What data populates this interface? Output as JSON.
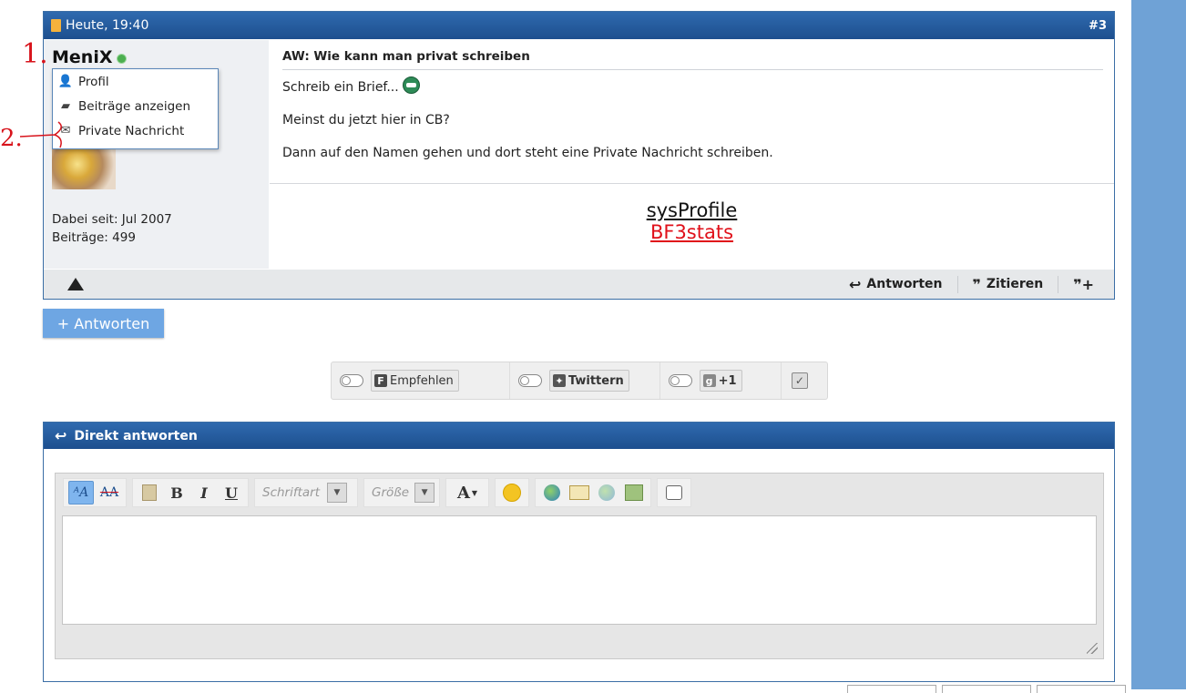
{
  "post": {
    "date": "Heute, 19:40",
    "number": "#3",
    "username": "MeniX",
    "joined": "Dabei seit: Jul 2007",
    "posts": "Beiträge: 499",
    "title": "AW: Wie kann man privat schreiben",
    "body_line1": "Schreib ein Brief...",
    "body_line2": "Meinst du jetzt hier in CB?",
    "body_line3": "Dann auf den Namen gehen und dort steht eine Private Nachricht schreiben.",
    "sig_link1": "sysProfile",
    "sig_link2": "BF3stats",
    "actions": {
      "reply": "Antworten",
      "quote": "Zitieren"
    }
  },
  "user_menu": {
    "items": [
      {
        "label": "Profil",
        "icon": "person-icon"
      },
      {
        "label": "Beiträge anzeigen",
        "icon": "posts-icon"
      },
      {
        "label": "Private Nachricht",
        "icon": "envelope-icon"
      }
    ]
  },
  "annotations": {
    "one": "1.",
    "two": "2."
  },
  "reply_button": "+ Antworten",
  "social": {
    "facebook": "Empfehlen",
    "facebook_logo": "F",
    "twitter": "Twittern",
    "gplus": "+1",
    "gplus_logo": "g"
  },
  "direct_reply": {
    "title": "Direkt antworten",
    "font_placeholder": "Schriftart",
    "size_placeholder": "Größe",
    "bold": "B",
    "italic": "I",
    "underline": "U",
    "font_color": "A"
  },
  "colors": {
    "header_blue": "#1d4f8e",
    "accent_red": "#e0101a",
    "side_blue": "#6fa2d6"
  }
}
